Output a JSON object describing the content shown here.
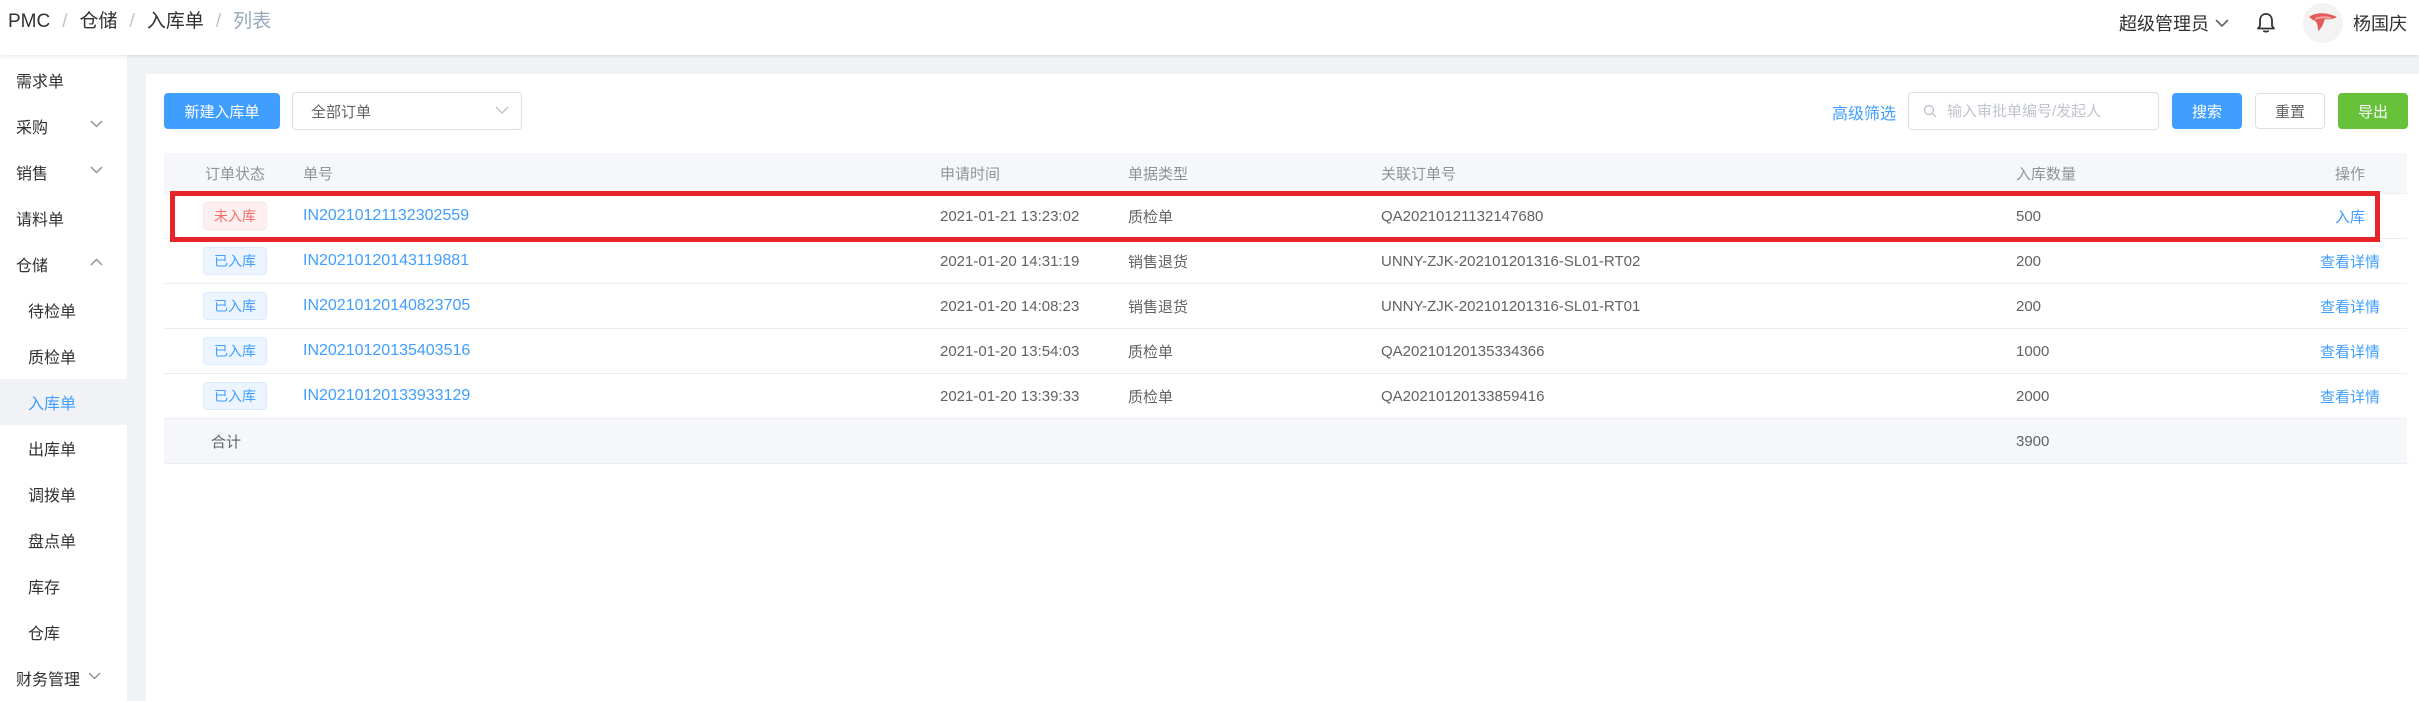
{
  "header": {
    "breadcrumb": [
      "PMC",
      "仓储",
      "入库单",
      "列表"
    ],
    "role": "超级管理员",
    "username": "杨国庆"
  },
  "sidebar": {
    "items": [
      {
        "label": "需求单",
        "chevron": ""
      },
      {
        "label": "采购",
        "chevron": "down"
      },
      {
        "label": "销售",
        "chevron": "down"
      },
      {
        "label": "请料单",
        "chevron": ""
      },
      {
        "label": "仓储",
        "chevron": "up"
      },
      {
        "label": "待检单",
        "chevron": ""
      },
      {
        "label": "质检单",
        "chevron": ""
      },
      {
        "label": "入库单",
        "chevron": "",
        "active": true
      },
      {
        "label": "出库单",
        "chevron": ""
      },
      {
        "label": "调拨单",
        "chevron": ""
      },
      {
        "label": "盘点单",
        "chevron": ""
      },
      {
        "label": "库存",
        "chevron": ""
      },
      {
        "label": "仓库",
        "chevron": ""
      },
      {
        "label": "财务管理",
        "chevron": "down"
      }
    ]
  },
  "toolbar": {
    "new_button": "新建入库单",
    "order_filter": "全部订单",
    "advanced_filter": "高级筛选",
    "search_placeholder": "输入审批单编号/发起人",
    "search_button": "搜索",
    "reset_button": "重置",
    "export_button": "导出"
  },
  "table": {
    "columns": [
      "订单状态",
      "单号",
      "申请时间",
      "单据类型",
      "关联订单号",
      "入库数量",
      "操作"
    ],
    "rows": [
      {
        "status": "未入库",
        "status_type": "danger",
        "no": "IN20210121132302559",
        "time": "2021-01-21 13:23:02",
        "type": "质检单",
        "related": "QA20210121132147680",
        "qty": "500",
        "action": "入库"
      },
      {
        "status": "已入库",
        "status_type": "info",
        "no": "IN20210120143119881",
        "time": "2021-01-20 14:31:19",
        "type": "销售退货",
        "related": "UNNY-ZJK-202101201316-SL01-RT02",
        "qty": "200",
        "action": "查看详情"
      },
      {
        "status": "已入库",
        "status_type": "info",
        "no": "IN20210120140823705",
        "time": "2021-01-20 14:08:23",
        "type": "销售退货",
        "related": "UNNY-ZJK-202101201316-SL01-RT01",
        "qty": "200",
        "action": "查看详情"
      },
      {
        "status": "已入库",
        "status_type": "info",
        "no": "IN20210120135403516",
        "time": "2021-01-20 13:54:03",
        "type": "质检单",
        "related": "QA20210120135334366",
        "qty": "1000",
        "action": "查看详情"
      },
      {
        "status": "已入库",
        "status_type": "info",
        "no": "IN20210120133933129",
        "time": "2021-01-20 13:39:33",
        "type": "质检单",
        "related": "QA20210120133859416",
        "qty": "2000",
        "action": "查看详情"
      }
    ],
    "total": {
      "label": "合计",
      "qty": "3900"
    }
  },
  "colors": {
    "primary": "#409eff",
    "success": "#67c23a",
    "danger": "#f56c6c",
    "highlight": "#e8242b"
  }
}
